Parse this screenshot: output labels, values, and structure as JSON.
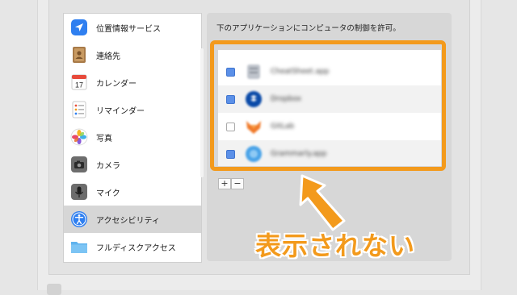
{
  "sidebar": {
    "items": [
      {
        "label": "位置情報サービス",
        "icon": "location-arrow-icon",
        "selected": false
      },
      {
        "label": "連絡先",
        "icon": "contacts-book-icon",
        "selected": false
      },
      {
        "label": "カレンダー",
        "icon": "calendar-icon",
        "selected": false,
        "icon_text": "17"
      },
      {
        "label": "リマインダー",
        "icon": "reminders-icon",
        "selected": false
      },
      {
        "label": "写真",
        "icon": "photos-icon",
        "selected": false
      },
      {
        "label": "カメラ",
        "icon": "camera-icon",
        "selected": false
      },
      {
        "label": "マイク",
        "icon": "microphone-icon",
        "selected": false
      },
      {
        "label": "アクセシビリティ",
        "icon": "accessibility-icon",
        "selected": true
      },
      {
        "label": "フルディスクアクセス",
        "icon": "folder-icon",
        "selected": false
      }
    ]
  },
  "right_pane": {
    "caption": "下のアプリケーションにコンピュータの制御を許可。",
    "apps": [
      {
        "name": "CheatSheet.app",
        "checked": true,
        "icon": "blurred-app-icon"
      },
      {
        "name": "Dropbox",
        "checked": true,
        "icon": "blurred-dropbox-icon"
      },
      {
        "name": "GitLab",
        "checked": false,
        "icon": "blurred-fox-icon"
      },
      {
        "name": "Grammarly.app",
        "checked": true,
        "icon": "blurred-app-icon"
      }
    ],
    "add_label": "+",
    "remove_label": "−"
  },
  "annotation": {
    "text": "表示されない",
    "color": "#f39a1c"
  },
  "colors": {
    "accent_blue": "#5b90e8",
    "highlight_orange": "#f39a1c"
  }
}
